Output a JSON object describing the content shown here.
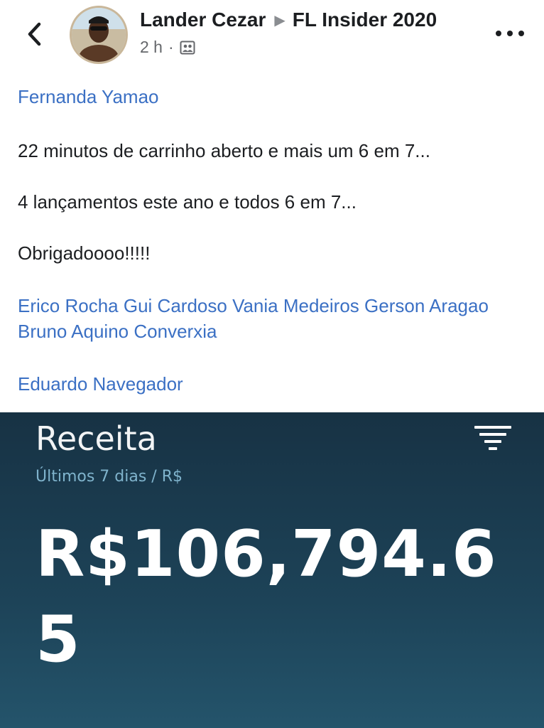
{
  "header": {
    "author": "Lander Cezar",
    "group": "FL Insider 2020",
    "time": "2 h",
    "separator": "·",
    "audience_icon": "group-audience-icon",
    "back_icon": "chevron-left-icon",
    "more_icon": "more-horizontal-icon"
  },
  "post": {
    "mention_top": "Fernanda Yamao",
    "line1": "22 minutos de carrinho aberto e mais um 6 em 7...",
    "line2": "4 lançamentos este ano e todos 6 em 7...",
    "line3": "Obrigadoooo!!!!!",
    "mentions": [
      "Erico Rocha",
      "Gui Cardoso",
      "Vania Medeiros",
      "Gerson Aragao",
      "Bruno Aquino",
      "Converxia"
    ],
    "mention_bottom": "Eduardo Navegador"
  },
  "image": {
    "title": "Receita",
    "subtitle": "Últimos 7 dias / R$",
    "value": "R$106,794.65",
    "filter_icon": "filter-icon"
  },
  "colors": {
    "link": "#3b70c4",
    "panel_bg": "#1d4358",
    "panel_sub": "#7fb3cc"
  }
}
